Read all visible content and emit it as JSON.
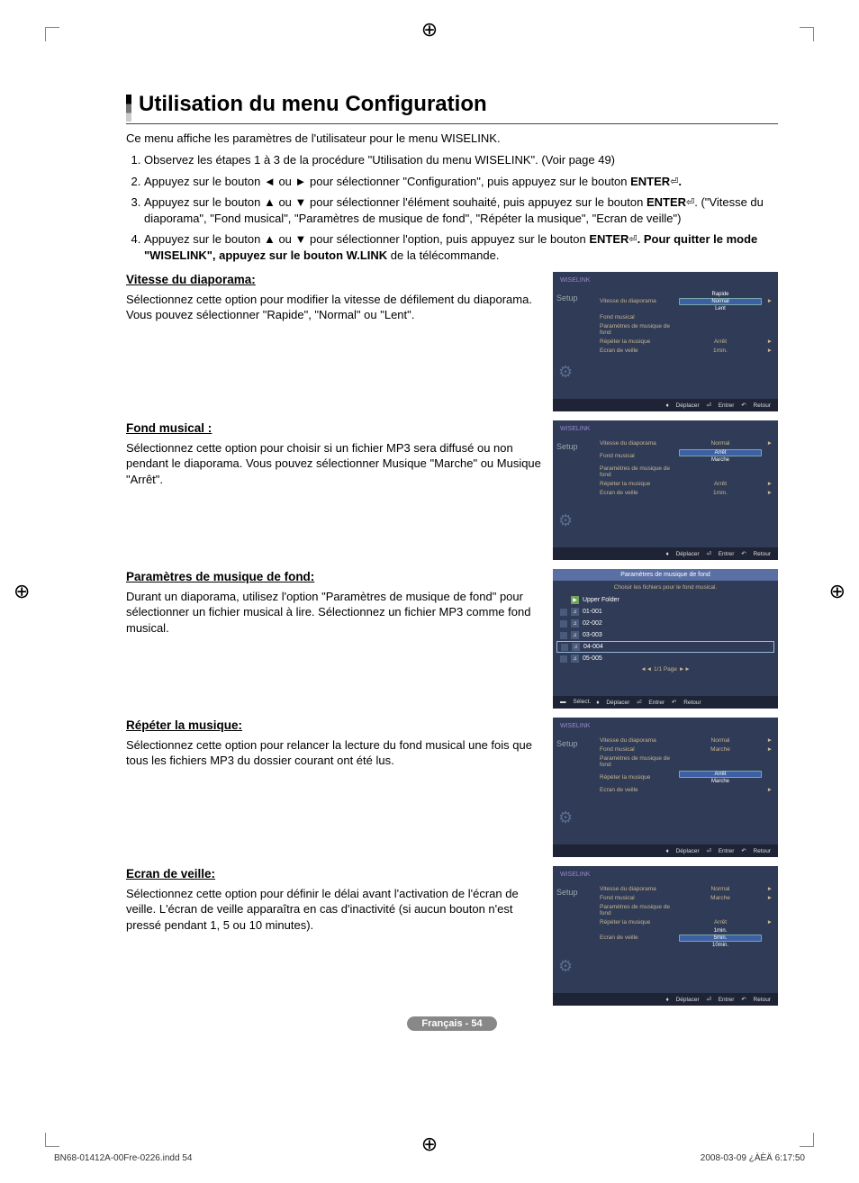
{
  "title": "Utilisation du menu Configuration",
  "intro": "Ce menu affiche les paramètres de l'utilisateur pour le menu WISELINK.",
  "steps": [
    {
      "text": "Observez les étapes 1 à 3 de la procédure \"Utilisation du menu WISELINK\". (Voir page 49)"
    },
    {
      "pre": "Appuyez sur le bouton ◄ ou ► pour sélectionner \"Configuration\", puis appuyez sur le bouton ",
      "bold": "ENTER",
      "post": "."
    },
    {
      "pre": "Appuyez sur le bouton ▲ ou ▼ pour sélectionner l'élément souhaité, puis appuyez sur le bouton ",
      "bold": "ENTER",
      "post": ". (\"Vitesse du diaporama\", \"Fond musical\", \"Paramètres de musique de fond\", \"Répéter la musique\", \"Ecran de veille\")"
    },
    {
      "pre": "Appuyez sur le bouton ▲ ou ▼ pour sélectionner l'option, puis appuyez sur le bouton ",
      "bold": "ENTER",
      "post": ". Pour quitter le mode \"WISELINK\", appuyez sur le bouton ",
      "bold2": "W.LINK",
      "post2": " de la télécommande."
    }
  ],
  "sections": {
    "speed": {
      "heading": "Vitesse du diaporama:",
      "body": "Sélectionnez cette option pour modifier la vitesse de défilement du diaporama. Vous pouvez sélectionner \"Rapide\", \"Normal\" ou \"Lent\"."
    },
    "bgmusic": {
      "heading": "Fond musical :",
      "body": "Sélectionnez cette option pour choisir si un fichier MP3 sera diffusé ou non pendant le diaporama. Vous pouvez sélectionner Musique \"Marche\" ou Musique \"Arrêt\"."
    },
    "bgsettings": {
      "heading": "Paramètres de musique de fond:",
      "body": "Durant un diaporama, utilisez l'option \"Paramètres de musique de fond\" pour sélectionner un fichier musical à lire. Sélectionnez un fichier MP3 comme fond musical."
    },
    "repeat": {
      "heading": "Répéter la musique:",
      "body": "Sélectionnez cette option pour relancer la lecture du fond musical une fois que tous les fichiers MP3 du dossier courant ont été lus."
    },
    "saver": {
      "heading": "Ecran de veille:",
      "body": "Sélectionnez cette option pour définir le délai avant l'activation de l'écran de veille. L'écran de veille apparaîtra en cas d'inactivité (si aucun bouton n'est pressé pendant 1, 5 ou 10 minutes)."
    }
  },
  "tv_common": {
    "brand": "WISELINK",
    "tab": "Setup",
    "footer_move": "Déplacer",
    "footer_enter": "Entrer",
    "footer_return": "Retour",
    "footer_select": "Sélect.",
    "labels": {
      "speed": "Vitesse du diaporama",
      "bg": "Fond musical",
      "bgset": "Paramètres de musique de fond",
      "repeat": "Répéter la musique",
      "saver": "Ecran de veille"
    }
  },
  "tv_speed": {
    "options": [
      "Rapide",
      "Normal",
      "Lent"
    ],
    "selected": "Normal",
    "repeat_val": "Arrêt",
    "saver_val": "1min."
  },
  "tv_bg": {
    "speed_val": "Normal",
    "options": [
      "Arrêt",
      "Marche"
    ],
    "selected": "Arrêt",
    "repeat_val": "Arrêt",
    "saver_val": "1min."
  },
  "tv_files": {
    "title": "Paramètres de musique de fond",
    "subtitle": "Choisir les fichiers pour le fond musical.",
    "upper": "Upper Folder",
    "items": [
      "01-001",
      "02-002",
      "03-003",
      "04-004",
      "05-005"
    ],
    "selected": "04-004",
    "pager": "◄◄ 1/1 Page ►►"
  },
  "tv_repeat": {
    "speed_val": "Normal",
    "bg_val": "Marche",
    "options": [
      "Arrêt",
      "Marche"
    ],
    "selected": "Arrêt",
    "saver_val": ""
  },
  "tv_saver": {
    "speed_val": "Normal",
    "bg_val": "Marche",
    "repeat_val": "Arrêt",
    "options": [
      "1min.",
      "5min.",
      "10min."
    ],
    "selected": "5min."
  },
  "page_badge": "Français - 54",
  "doc_footer_left": "BN68-01412A-00Fre-0226.indd   54",
  "doc_footer_right": "2008-03-09   ¿ÀÈÄ 6:17:50"
}
